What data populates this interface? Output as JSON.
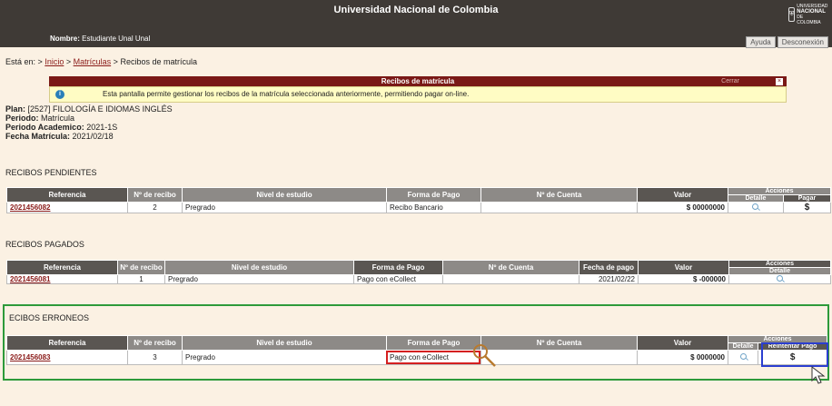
{
  "header": {
    "title": "Universidad Nacional de Colombia",
    "user_label": "Nombre:",
    "user_name": "Estudiante Unal Unal",
    "logo_line1": "UNIVERSIDAD",
    "logo_line2": "NACIONAL",
    "logo_line3": "DE COLOMBIA",
    "help_label": "Ayuda",
    "logout_label": "Desconexión"
  },
  "breadcrumb": {
    "prefix": "Está en:",
    "sep": ">",
    "home": "Inicio",
    "matriculas": "Matrículas",
    "current": "Recibos de matrícula"
  },
  "notice": {
    "title": "Recibos de matrícula",
    "close_label": "Cerrar",
    "close_x": "×",
    "message": "Esta pantalla permite gestionar los recibos de la matrícula seleccionada anteriormente, permitiendo pagar on-line."
  },
  "meta": {
    "plan_label": "Plan:",
    "plan_value": "[2527]  FILOLOGÍA E IDIOMAS INGLÉS",
    "periodo_label": "Periodo:",
    "periodo_value": "Matrícula",
    "academico_label": "Periodo Academico:",
    "academico_value": "2021-1S",
    "fecha_label": "Fecha Matrícula:",
    "fecha_value": "2021/02/18"
  },
  "pendientes": {
    "title": "RECIBOS PENDIENTES",
    "headers": [
      "Referencia",
      "Nº de recibo",
      "Nivel de estudio",
      "Forma de Pago",
      "Nº de Cuenta",
      "Valor",
      "Acciones"
    ],
    "sub_headers": [
      "Detalle",
      "Pagar"
    ],
    "row": {
      "ref": "2021456082",
      "num": "2",
      "nivel": "Pregrado",
      "forma": "Recibo Bancario",
      "cuenta": "",
      "valor": "$ 00000000",
      "pay": "$"
    }
  },
  "pagados": {
    "title": "RECIBOS PAGADOS",
    "headers": [
      "Referencia",
      "Nº de recibo",
      "Nivel de estudio",
      "Forma de Pago",
      "Nº de Cuenta",
      "Fecha de pago",
      "Valor",
      "Acciones"
    ],
    "sub_headers": [
      "Detalle"
    ],
    "row": {
      "ref": "2021456081",
      "num": "1",
      "nivel": "Pregrado",
      "forma": "Pago con eCollect",
      "cuenta": "",
      "fecha": "2021/02/22",
      "valor": "$ -000000"
    }
  },
  "erroneos": {
    "title": "ECIBOS ERRONEOS",
    "headers": [
      "Referencia",
      "Nº de recibo",
      "Nivel de estudio",
      "Forma de Pago",
      "Nº de Cuenta",
      "Valor",
      "Acciones"
    ],
    "sub_headers": [
      "Detalle",
      "Reintentar Pago"
    ],
    "row": {
      "ref": "2021456083",
      "num": "3",
      "nivel": "Pregrado",
      "forma": "Pago con eCollect",
      "cuenta": "",
      "valor": "$ 0000000",
      "pay": "$"
    }
  },
  "colors": {
    "header_bg": "#3f3a36",
    "page_bg": "#fbf1e3",
    "link": "#8a1a18",
    "highlight_green": "#2d9a3a",
    "highlight_red": "#d42020",
    "highlight_blue": "#2b3ed0"
  },
  "icons": [
    "seal-icon",
    "info-icon",
    "magnifier-icon",
    "dollar-icon",
    "zoom-icon",
    "cursor-icon"
  ]
}
